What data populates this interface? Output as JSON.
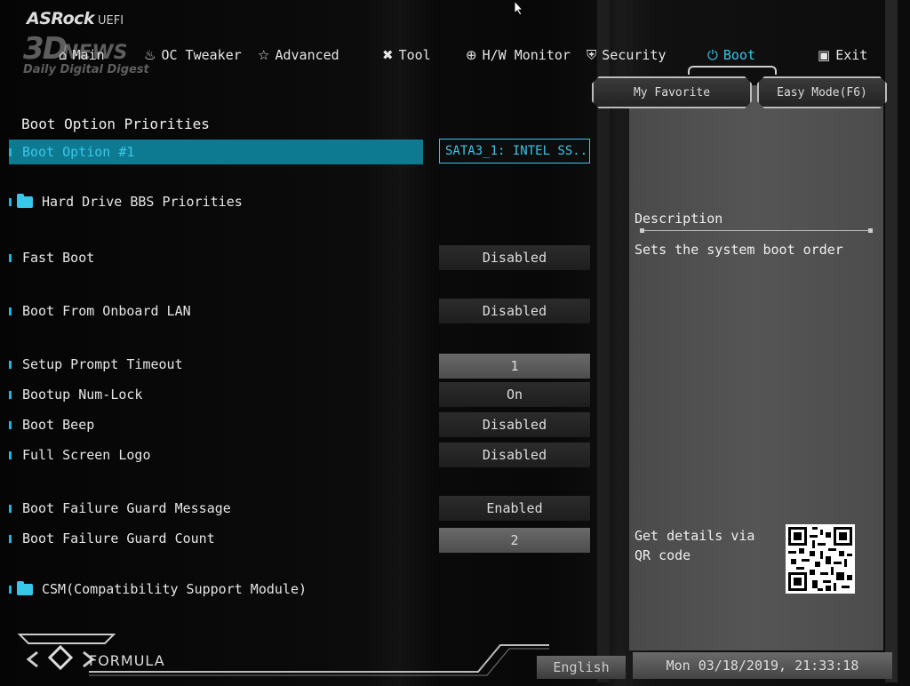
{
  "brand": {
    "name": "ASRock",
    "suffix": "UEFI"
  },
  "watermark": {
    "big": "3D",
    "news": "NEWS",
    "tagline": "Daily Digital Digest"
  },
  "tabs": [
    {
      "label": "Main",
      "icon": "home-icon"
    },
    {
      "label": "OC Tweaker",
      "icon": "rocket-icon"
    },
    {
      "label": "Advanced",
      "icon": "star-icon"
    },
    {
      "label": "Tool",
      "icon": "tools-icon"
    },
    {
      "label": "H/W Monitor",
      "icon": "monitor-icon"
    },
    {
      "label": "Security",
      "icon": "shield-icon"
    },
    {
      "label": "Boot",
      "icon": "power-icon",
      "active": true
    },
    {
      "label": "Exit",
      "icon": "exit-icon"
    }
  ],
  "buttons": {
    "favorite": "My Favorite",
    "easy_mode": "Easy Mode(F6)"
  },
  "section_title": "Boot Option Priorities",
  "boot_option_1": {
    "label": "Boot Option #1",
    "value": "SATA3_1: INTEL SS..."
  },
  "hdd_bbs": "Hard Drive BBS Priorities",
  "settings": {
    "fast_boot": {
      "label": "Fast Boot",
      "value": "Disabled"
    },
    "boot_lan": {
      "label": "Boot From Onboard LAN",
      "value": "Disabled"
    },
    "setup_timeout": {
      "label": "Setup Prompt Timeout",
      "value": "1"
    },
    "numlock": {
      "label": "Bootup Num-Lock",
      "value": "On"
    },
    "boot_beep": {
      "label": "Boot Beep",
      "value": "Disabled"
    },
    "full_logo": {
      "label": "Full Screen Logo",
      "value": "Disabled"
    },
    "bfg_message": {
      "label": "Boot Failure Guard Message",
      "value": "Enabled"
    },
    "bfg_count": {
      "label": "Boot Failure Guard Count",
      "value": "2"
    }
  },
  "csm": "CSM(Compatibility Support Module)",
  "description": {
    "title": "Description",
    "text": "Sets the system boot order",
    "qr_text": "Get details via QR code"
  },
  "footer": {
    "formula": "FORMULA",
    "language": "English",
    "datetime": "Mon 03/18/2019, 21:33:18"
  },
  "accent_color": "#39c6e8"
}
